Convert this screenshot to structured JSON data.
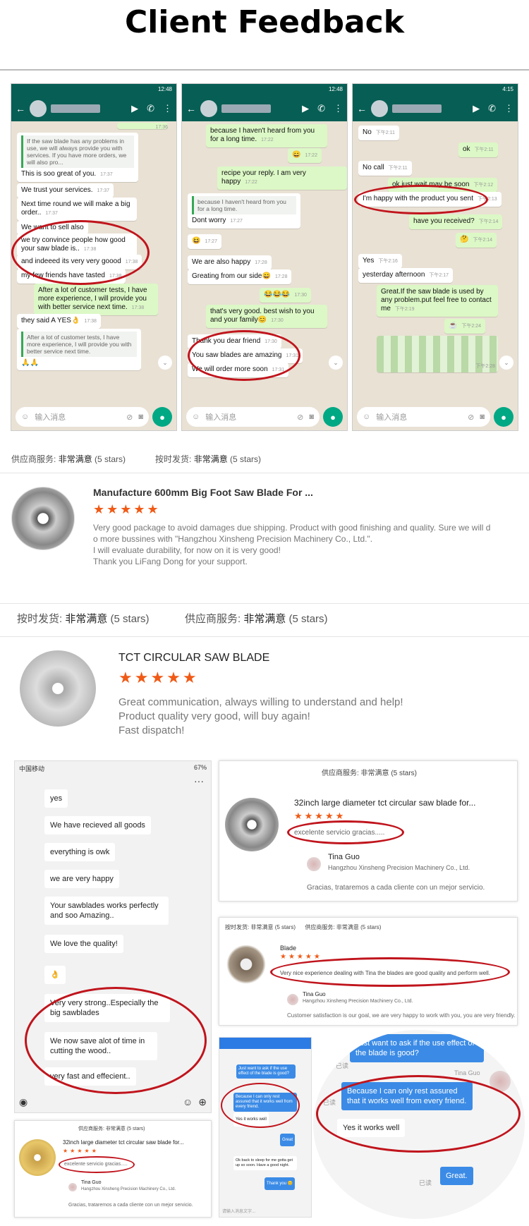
{
  "title": "Client Feedback",
  "phones": {
    "clock1": "12:48",
    "clock2": "12:48",
    "clock3": "4:15",
    "input_placeholder": "输入消息",
    "p1": {
      "q1": "If the saw blade has any problems in use, we will always provide you with services. If you have more orders, we will also pro...",
      "t1": "17:36",
      "m1": "This is soo great of you.",
      "t_m1": "17:37",
      "m2": "We trust your services.",
      "t_m2": "17:37",
      "m3": "Next time round we will make a big order..",
      "t_m3": "17:37",
      "m4": "We want to sell also",
      "m5": "we try convince people how good your saw blade is..",
      "t_m5": "17:38",
      "m6": "and indeeed its very very goood",
      "t_m6": "17:38",
      "m7": "my few friends have tasted",
      "t_m7": "17:38",
      "m8": "After a lot of customer tests, I have more experience, I will provide you with better service next time.",
      "t_m8": "17:38",
      "m9": "they said A YES",
      "t_m9": "17:38",
      "q2": "After a lot of customer tests, I have more experience, I will provide you with better service next time."
    },
    "p2": {
      "m1": "because I haven't heard from you for a long time.",
      "t_m1": "17:22",
      "t_m2": "17:22",
      "m3": "recipe your reply.  I am very happy",
      "t_m3": "17:22",
      "q1": "because I haven't heard from you for a long time.",
      "m4": "Dont worry",
      "t_m4": "17:27",
      "t_m5": "17:27",
      "m6": "We are also happy",
      "t_m6": "17:28",
      "m7": "Greating from our side",
      "t_m7": "17:28",
      "t_m8": "17:30",
      "m9": "that's very good.  best wish to you and your family",
      "t_m9": "17:30",
      "m10": "Thank you dear friend",
      "t_m10": "17:30",
      "m11": "You saw blades are amazing",
      "t_m11": "17:31",
      "m12": "We will order more soon",
      "t_m12": "17:31"
    },
    "p3": {
      "m1": "No",
      "t_m1": "下午2:11",
      "m2": "ok",
      "t_m2": "下午2:11",
      "m3": "No call",
      "t_m3": "下午2:11",
      "m4": "ok just wait may be soon",
      "t_m4": "下午2:12",
      "m5": "I'm happy with the product you sent",
      "t_m5": "下午2:13",
      "m6": "have you received?",
      "t_m6": "下午2:14",
      "t_m7": "下午2:14",
      "m8": "Yes",
      "t_m8": "下午2:16",
      "m9": "yesterday afternoon",
      "t_m9": "下午2:17",
      "m10": "Great.If the saw blade is used by any problem.put feel free to contact me",
      "t_m10": "下午2:19",
      "t_m11": "下午2:24",
      "t_m12": "下午2:28"
    }
  },
  "review1": {
    "label1": "供应商服务:",
    "val1": "非常满意",
    "stars1": "(5 stars)",
    "label2": "按时发货:",
    "val2": "非常满意",
    "stars2": "(5 stars)",
    "product": "Manufacture 600mm Big Foot Saw Blade For ...",
    "stars": "★★★★★",
    "line1": "Very good package to avoid damages due shipping. Product with good finishing and quality. Sure we will d",
    "line2": "o more bussines with \"Hangzhou Xinsheng Precision Machinery Co., Ltd.\".",
    "line3": "I will evaluate durability, for now on it is very good!",
    "line4": "Thank you LiFang Dong for your support."
  },
  "review2": {
    "label1": "按时发货:",
    "val1": "非常满意",
    "stars1": "(5 stars)",
    "label2": "供应商服务:",
    "val2": "非常满意",
    "stars2": "(5 stars)",
    "product": "TCT CIRCULAR SAW BLADE",
    "stars": "★★★★★",
    "line1": "Great communication, always willing to understand and help!",
    "line2": "Product quality very good, will buy again!",
    "line3": "Fast dispatch!"
  },
  "wechat": {
    "carrier": "中国移动",
    "battery": "67%",
    "m1": "yes",
    "m2": "We have recieved all goods",
    "m3": "everything is owk",
    "m4": "we are very happy",
    "m5": "Your sawblades works perfectly and soo Amazing..",
    "m6": "We love the quality!",
    "m7": "👌",
    "m8": "Very very strong..Especially the big sawblades",
    "m9": "We now save alot of time in cutting the wood..",
    "m10": "very fast and effecient.."
  },
  "card1": {
    "header": "供应商服务: 非常满意",
    "stars": "(5 stars)",
    "product": "32inch large diameter tct circular saw blade for...",
    "rating": "★★★★★",
    "review": "excelente servicio gracias.....",
    "name": "Tina Guo",
    "company": "Hangzhou Xinsheng Precision Machinery Co., Ltd.",
    "reply": "Gracias, trataremos a cada cliente con un mejor servicio."
  },
  "card2": {
    "l1": "按时发货: 非常满意",
    "s1": "(5 stars)",
    "l2": "供应商服务: 非常满意",
    "s2": "(5 stars)",
    "product": "Blade",
    "rating": "★★★★★",
    "review": "Very nice experience dealing with Tina the blades are good quality and perform well.",
    "name": "Tina Guo",
    "company": "Hangzhou Xinsheng Precision Machinery Co., Ltd.",
    "reply": "Customer satisfaction is our goal, we are very happy to work with you, you are very friendly."
  },
  "card3": {
    "header": "供应商服务: 非常满意",
    "stars": "(5 stars)",
    "product": "32inch large diameter tct circular saw blade for...",
    "rating": "★★★★★",
    "review": "excelente servicio gracias.....",
    "name": "Tina Guo",
    "company": "Hangzhou Xinsheng Precision Machinery Co., Ltd.",
    "reply": "Gracias, trataremos a cada cliente con un mejor servicio."
  },
  "zoom": {
    "m1": "Just want to ask if the use effect of the blade is good?",
    "read1": "已读",
    "name": "Tina Guo",
    "m2": "Because I can only rest assured that it works well from every friend.",
    "read2": "已读",
    "m3": "Yes it works well",
    "m4": "Great.",
    "read3": "已读",
    "small1": "Just want to ask if the use effect of the blade is good?",
    "small2": "Because I can only rest assured that it works well from every friend.",
    "small3": "Yes it works well",
    "small4": "Great",
    "small5": "Ok back to sleep for me gotta get up so soon. Have a good night.",
    "small6": "Thank you 😊",
    "placeholder": "请输入消息文字..."
  }
}
